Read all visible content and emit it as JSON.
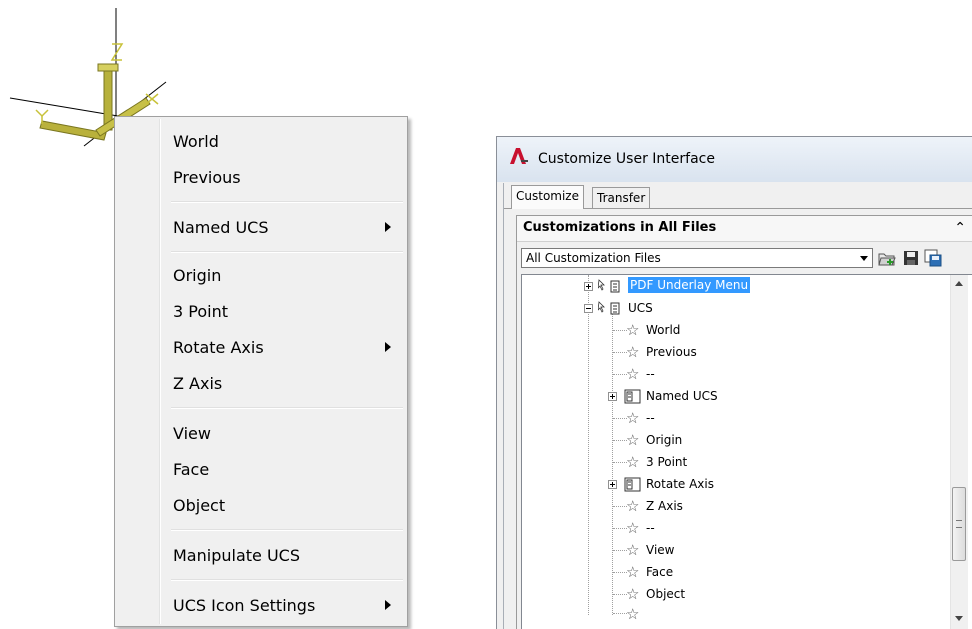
{
  "ucs_icon": {
    "z_label": "Z",
    "x_label": "X",
    "y_label": "Y"
  },
  "context_menu": {
    "items": [
      {
        "label": "World",
        "submenu": false
      },
      {
        "label": "Previous",
        "submenu": false
      },
      {
        "label": "Named UCS",
        "submenu": true
      },
      {
        "label": "Origin",
        "submenu": false
      },
      {
        "label": "3 Point",
        "submenu": false
      },
      {
        "label": "Rotate Axis",
        "submenu": true
      },
      {
        "label": "Z Axis",
        "submenu": false
      },
      {
        "label": "View",
        "submenu": false
      },
      {
        "label": "Face",
        "submenu": false
      },
      {
        "label": "Object",
        "submenu": false
      },
      {
        "label": "Manipulate UCS",
        "submenu": false
      },
      {
        "label": "UCS Icon Settings",
        "submenu": true
      }
    ]
  },
  "cui_window": {
    "title": "Customize User Interface",
    "tabs": [
      "Customize",
      "Transfer"
    ],
    "panel_title": "Customizations in All Files",
    "filter_value": "All Customization Files",
    "tree": [
      {
        "label": "PDF Underlay Menu",
        "selected": true
      },
      {
        "label": "UCS"
      },
      {
        "label": "World"
      },
      {
        "label": "Previous"
      },
      {
        "label": "--"
      },
      {
        "label": "Named UCS"
      },
      {
        "label": "--"
      },
      {
        "label": "Origin"
      },
      {
        "label": "3 Point"
      },
      {
        "label": "Rotate Axis"
      },
      {
        "label": "Z Axis"
      },
      {
        "label": "--"
      },
      {
        "label": "View"
      },
      {
        "label": "Face"
      },
      {
        "label": "Object"
      }
    ]
  },
  "colors": {
    "selection": "#3399ff",
    "axis_gold": "#c8c23a",
    "menu_bg": "#f0f0f0"
  }
}
